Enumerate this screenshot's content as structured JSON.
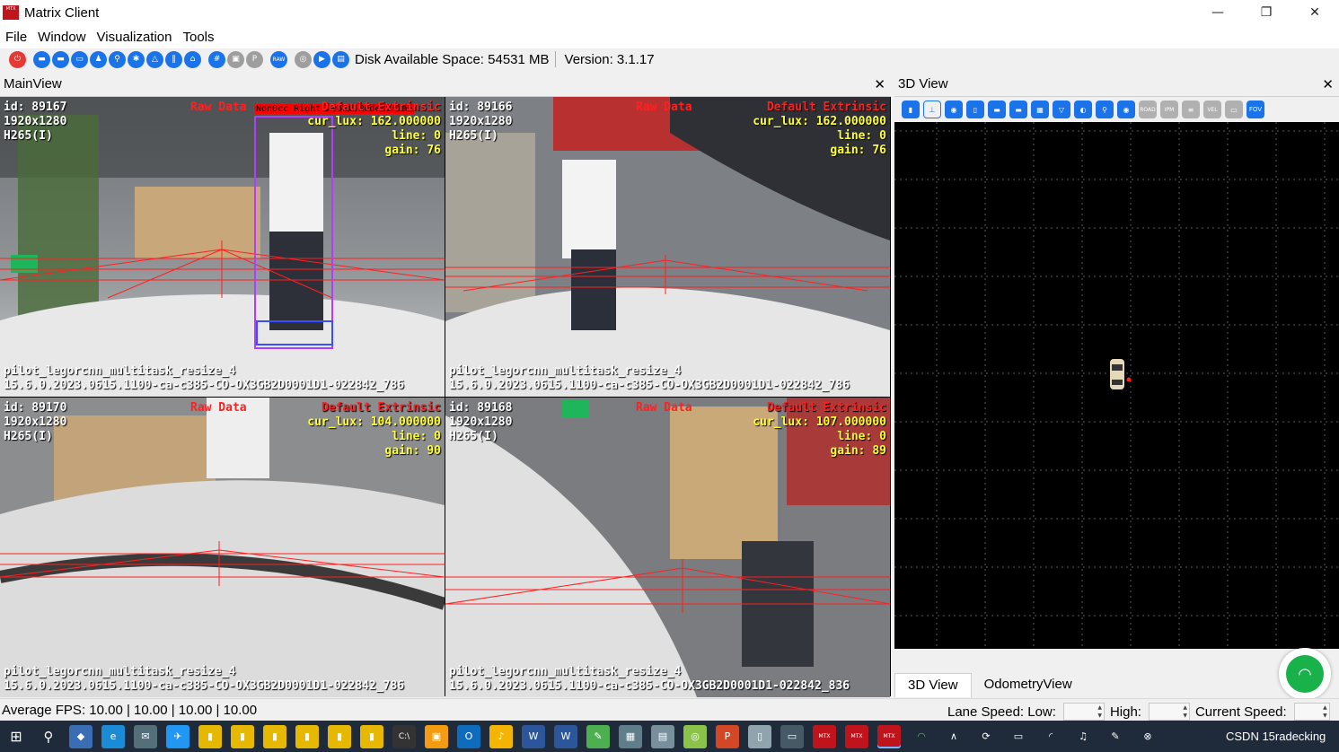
{
  "window": {
    "title": "Matrix Client",
    "logo_text": "Matrix Client",
    "controls": [
      "—",
      "❐",
      "✕"
    ]
  },
  "menu": [
    "File",
    "Window",
    "Visualization",
    "Tools"
  ],
  "toolbar": {
    "disk_space": "Disk Available Space: 54531 MB",
    "version": "Version: 3.1.17"
  },
  "main_view": {
    "title": "MainView",
    "close": "✕",
    "cameras": [
      {
        "id_line": "id: 89167",
        "res": "1920x1280",
        "codec": "H265(I)",
        "raw": "Raw Data",
        "extrinsic": "Default Extrinsic",
        "lux": "cur_lux: 162.000000",
        "line": "line: 0",
        "gain": "gain: 76",
        "model": "pilot_legorcnn_multitask_resize_4",
        "build": "15.6.0.2023.0615.1100-ca-c385-CO-OX3GB2D0001D1-022842_786",
        "detection_label": "NonOcc Right Front Pedestrian"
      },
      {
        "id_line": "id: 89166",
        "res": "1920x1280",
        "codec": "H265(I)",
        "raw": "Raw Data",
        "extrinsic": "Default Extrinsic",
        "lux": "cur_lux: 162.000000",
        "line": "line: 0",
        "gain": "gain: 76",
        "model": "pilot_legorcnn_multitask_resize_4",
        "build": "15.6.0.2023.0615.1100-ca-c385-CO-OX3GB2D0001D1-022842_786"
      },
      {
        "id_line": "id: 89170",
        "res": "1920x1280",
        "codec": "H265(I)",
        "raw": "Raw Data",
        "extrinsic": "Default Extrinsic",
        "lux": "cur_lux: 104.000000",
        "line": "line: 0",
        "gain": "gain: 90",
        "model": "pilot_legorcnn_multitask_resize_4",
        "build": "15.6.0.2023.0615.1100-ca-c385-CO-OX3GB2D0001D1-022842_786"
      },
      {
        "id_line": "id: 89168",
        "res": "1920x1280",
        "codec": "H265(I)",
        "raw": "Raw Data",
        "extrinsic": "Default Extrinsic",
        "lux": "cur_lux: 107.000000",
        "line": "line: 0",
        "gain": "gain: 89",
        "model": "pilot_legorcnn_multitask_resize_4",
        "build": "15.6.0.2023.0615.1100-ca-c385-CO-OX3GB2D0001D1-022842_836"
      }
    ]
  },
  "view3d": {
    "title": "3D View",
    "close": "✕",
    "tabs": [
      "3D View",
      "OdometryView"
    ]
  },
  "status": {
    "fps": "Average FPS: 10.00 | 10.00 | 10.00 | 10.00",
    "lane_speed_low": "Lane Speed: Low:",
    "high": "High:",
    "current_speed": "Current Speed:"
  },
  "taskbar": {
    "tray_text": "CSDN 15radecking"
  },
  "colors": {
    "overlay_red": "#ff2020",
    "overlay_yellow": "#ffff33",
    "icon_blue": "#1a73e8",
    "taskbar_bg": "#1f2a3a"
  }
}
